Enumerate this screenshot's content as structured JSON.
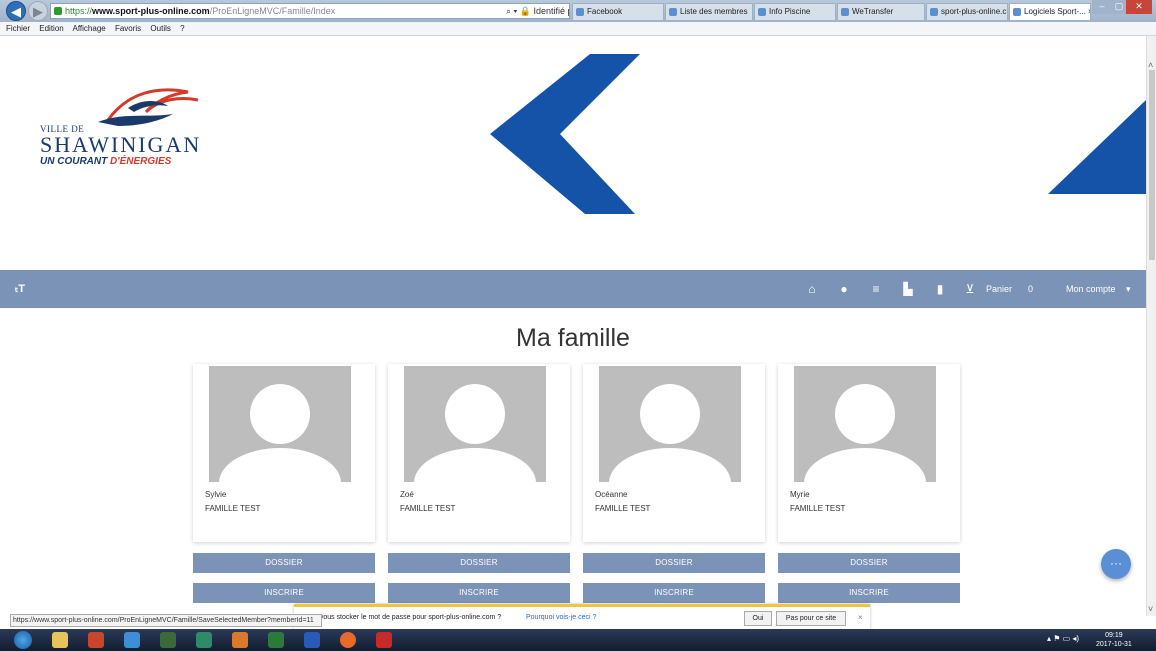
{
  "browser": {
    "url_https": "https://",
    "url_host": "www.sport-plus-online.com",
    "url_path": "/ProEnLigneMVC/Famille/Index",
    "address_tools": "⌕ ▾ 🔒 Identifié par Entrust.net  C",
    "tabs": [
      {
        "label": "Facebook"
      },
      {
        "label": "Liste des membres"
      },
      {
        "label": "Info Piscine"
      },
      {
        "label": "WeTransfer"
      },
      {
        "label": "sport-plus-online.c..."
      },
      {
        "label": "Logiciels Sport-... ×"
      }
    ],
    "menu": [
      "Fichier",
      "Edition",
      "Affichage",
      "Favoris",
      "Outils",
      "?"
    ]
  },
  "logo": {
    "ville": "VILLE DE",
    "name": "SHAWINIGAN",
    "slogan_a": "UN COURANT",
    "slogan_b": "D'ÉNERGIES"
  },
  "navbar": {
    "menu_icon": "text-size-icon",
    "cart_label": "Panier",
    "cart_count": "0",
    "account_label": "Mon compte",
    "account_caret": "▾"
  },
  "page_title": "Ma famille",
  "members": [
    {
      "first": "Sylvie",
      "last": "FAMILLE TEST"
    },
    {
      "first": "Zoé",
      "last": "FAMILLE TEST"
    },
    {
      "first": "Océanne",
      "last": "FAMILLE TEST"
    },
    {
      "first": "Myrie",
      "last": "FAMILLE TEST"
    }
  ],
  "buttons": {
    "dossier": "DOSSIER",
    "inscrire": "INSCRIRE"
  },
  "fab_label": "···",
  "status_url": "https://www.sport-plus-online.com/ProEnLigneMVC/Famille/SaveSelectedMember?memberId=11",
  "password_prompt": {
    "message": "z-vous stocker le mot de passe pour sport-plus-online.com ?",
    "why": "Pourquoi vois-je ceci ?",
    "yes": "Oui",
    "no": "Pas pour ce site",
    "close": "×",
    "ghost": "TE"
  },
  "taskbar": {
    "tray": "▴  ⚑  ▭  ◂)",
    "time": "09:19",
    "date": "2017-10-31"
  },
  "colors": {
    "navbar": "#7b93b6",
    "brand_blue": "#1553a8",
    "fab": "#5a8fd6"
  }
}
